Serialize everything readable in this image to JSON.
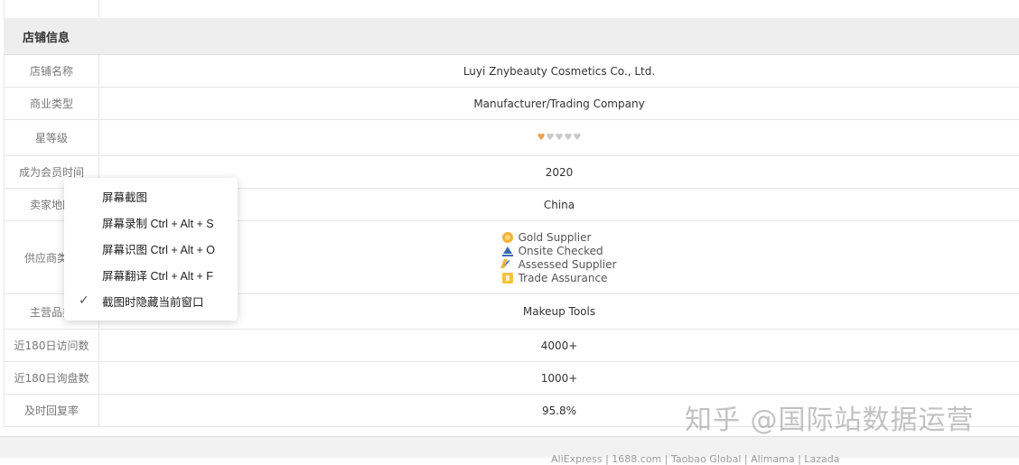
{
  "top_row": {
    "value": "--"
  },
  "section": {
    "title": "店铺信息"
  },
  "rows": [
    {
      "label": "店铺名称",
      "value": "Luyi Znybeauty Cosmetics Co., Ltd."
    },
    {
      "label": "商业类型",
      "value": "Manufacturer/Trading Company"
    },
    {
      "label": "星等级",
      "value": "",
      "stars": {
        "filled": 1,
        "total": 5
      }
    },
    {
      "label": "成为会员时间",
      "value": "2020"
    },
    {
      "label": "卖家地区",
      "value": "China"
    },
    {
      "label": "供应商类型",
      "value": ""
    },
    {
      "label": "主营品类",
      "value": "Makeup Tools"
    },
    {
      "label": "近180日访问数",
      "value": "4000+"
    },
    {
      "label": "近180日询盘数",
      "value": "1000+"
    },
    {
      "label": "及时回复率",
      "value": "95.8%"
    }
  ],
  "supplier_types": [
    {
      "icon": "gold-supplier-icon",
      "label": "Gold Supplier"
    },
    {
      "icon": "onsite-checked-icon",
      "label": "Onsite Checked"
    },
    {
      "icon": "assessed-supplier-icon",
      "label": "Assessed Supplier"
    },
    {
      "icon": "trade-assurance-icon",
      "label": "Trade Assurance"
    }
  ],
  "context_menu": {
    "items": [
      {
        "label": "屏幕截图",
        "checked": false
      },
      {
        "label": "屏幕录制 Ctrl + Alt + S",
        "checked": false
      },
      {
        "label": "屏幕识图 Ctrl + Alt + O",
        "checked": false
      },
      {
        "label": "屏幕翻译 Ctrl + Alt + F",
        "checked": false
      },
      {
        "label": "截图时隐藏当前窗口",
        "checked": true
      }
    ]
  },
  "watermark": "知乎 @国际站数据运营",
  "footer": {
    "text": "AliExpress | 1688.com | Taobao Global | Alimama | Lazada"
  },
  "colors": {
    "header_bg": "#eeeeee",
    "star_on": "#f0a04a",
    "star_off": "#c8c8c8"
  }
}
